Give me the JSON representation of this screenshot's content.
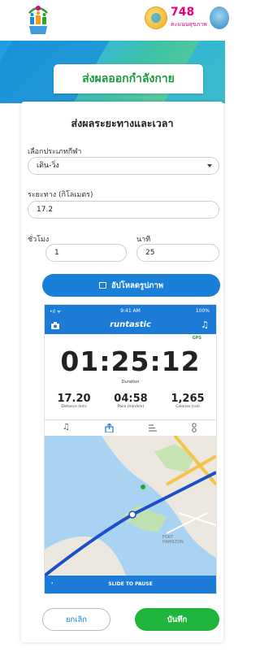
{
  "header": {
    "points": "748",
    "points_caption": "คะแนนสุขภาพ"
  },
  "banner": {
    "title": "ส่งผลออกกำลังกาย"
  },
  "form": {
    "title": "ส่งผลระยะทางและเวลา",
    "sport_label": "เลือกประเภทกีฬา",
    "sport_value": "เดิน-วิ่ง",
    "distance_label": "ระยะทาง (กิโลเมตร)",
    "distance_value": "17.2",
    "hours_label": "ชั่วโมง",
    "hours_value": "1",
    "minutes_label": "นาที",
    "minutes_value": "25",
    "upload_label": "อัปโหลดรูปภาพ",
    "cancel_label": "ยกเลิก",
    "save_label": "บันทึก"
  },
  "screenshot": {
    "status_time": "9:41 AM",
    "status_battery": "100%",
    "brand": "runtastic",
    "gps": "GPS",
    "duration": "01:25:12",
    "duration_label": "Duration",
    "stats": [
      {
        "value": "17.20",
        "label": "Distance (km)"
      },
      {
        "value": "04:58",
        "label": "Pace (min/km)"
      },
      {
        "value": "1,265",
        "label": "Calories (cal)"
      }
    ],
    "map_labels": {
      "fort": "FORT",
      "hamilton": "HAMILTON"
    },
    "slide_label": "SLIDE TO PAUSE"
  }
}
